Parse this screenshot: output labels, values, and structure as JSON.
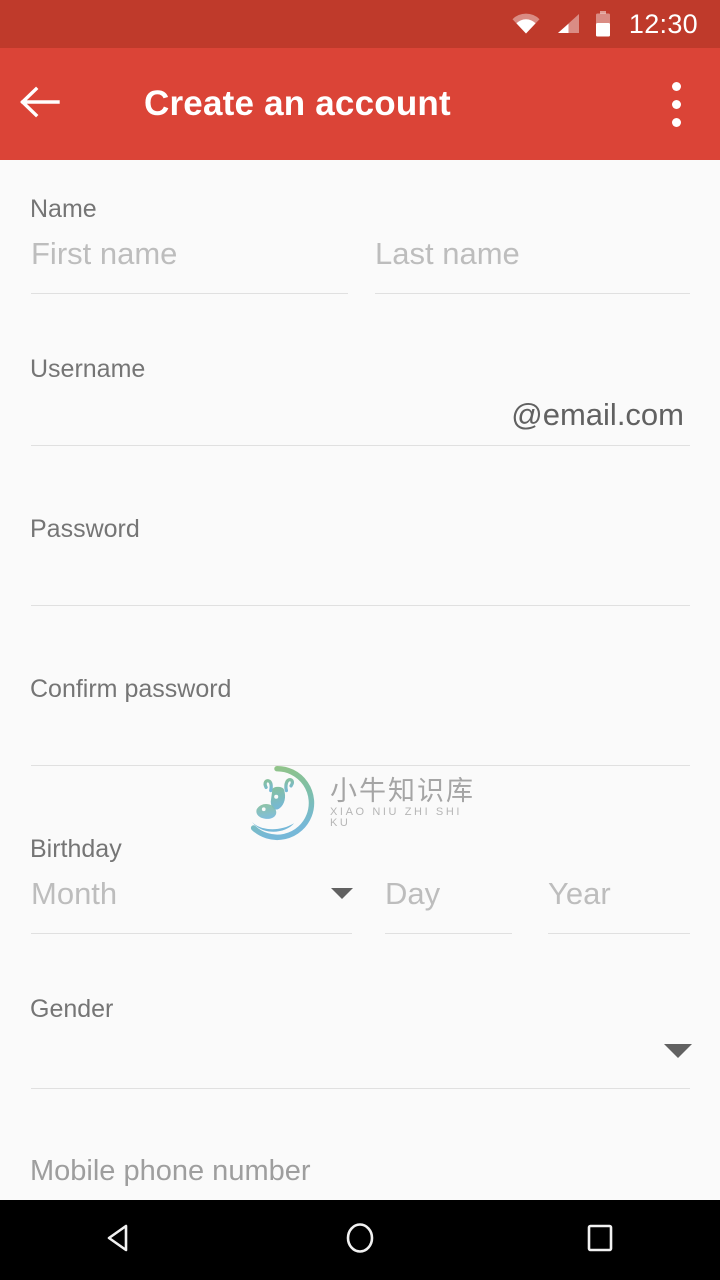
{
  "statusbar": {
    "time": "12:30",
    "icons": [
      "wifi-icon",
      "cellular-signal-icon",
      "battery-icon"
    ],
    "background": "#bf3a2b"
  },
  "appbar": {
    "title": "Create an account",
    "back_icon": "back-arrow-icon",
    "overflow_icon": "overflow-menu-icon",
    "background": "#db4437",
    "text_color": "#ffffff"
  },
  "form": {
    "name": {
      "label": "Name",
      "first_name_placeholder": "First name",
      "first_name_value": "",
      "last_name_placeholder": "Last name",
      "last_name_value": ""
    },
    "username": {
      "label": "Username",
      "value": "",
      "suffix": "@email.com"
    },
    "password": {
      "label": "Password",
      "value": ""
    },
    "confirm_password": {
      "label": "Confirm password",
      "value": ""
    },
    "birthday": {
      "label": "Birthday",
      "month_placeholder": "Month",
      "month_value": "",
      "day_placeholder": "Day",
      "day_value": "",
      "year_placeholder": "Year",
      "year_value": ""
    },
    "gender": {
      "label": "Gender",
      "value": ""
    },
    "mobile_phone": {
      "label": "Mobile phone number"
    }
  },
  "watermark": {
    "chinese": "小牛知识库",
    "pinyin": "XIAO NIU ZHI SHI KU",
    "mark_color_top": "#8cc07a",
    "mark_color_bottom": "#6bb3d6"
  },
  "navbar": {
    "back_label": "back-triangle-icon",
    "home_label": "home-circle-icon",
    "recents_label": "recents-square-icon",
    "background": "#000000"
  }
}
